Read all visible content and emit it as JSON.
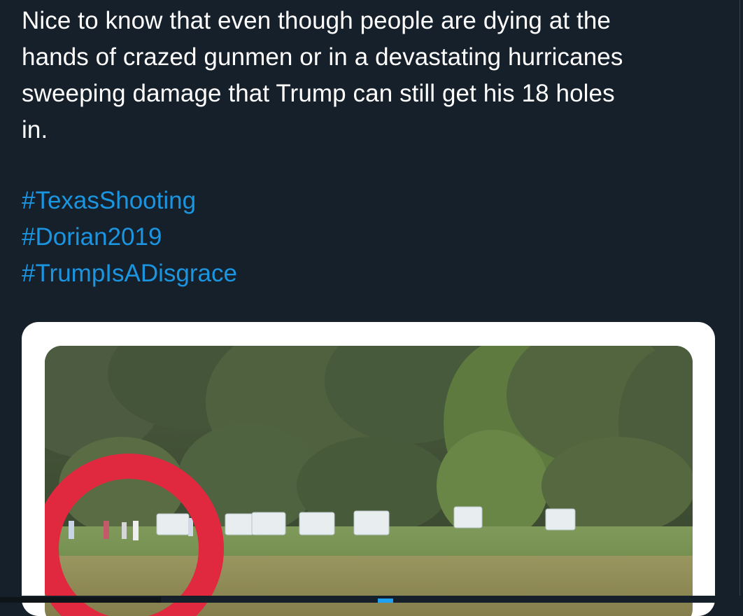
{
  "tweet": {
    "text_lines": [
      "Nice to know that even though people are dying at the",
      "hands of crazed gunmen or in a devastating hurricanes",
      "sweeping damage that Trump can still get his 18 holes",
      "in."
    ],
    "hashtags": [
      "#TexasShooting",
      "#Dorian2019",
      "#TrumpIsADisgrace"
    ]
  },
  "colors": {
    "background": "#15202b",
    "text": "#ffffff",
    "hashtag": "#1b95e0",
    "highlight_circle": "#e0283f"
  },
  "media": {
    "icon": "photo-icon"
  }
}
